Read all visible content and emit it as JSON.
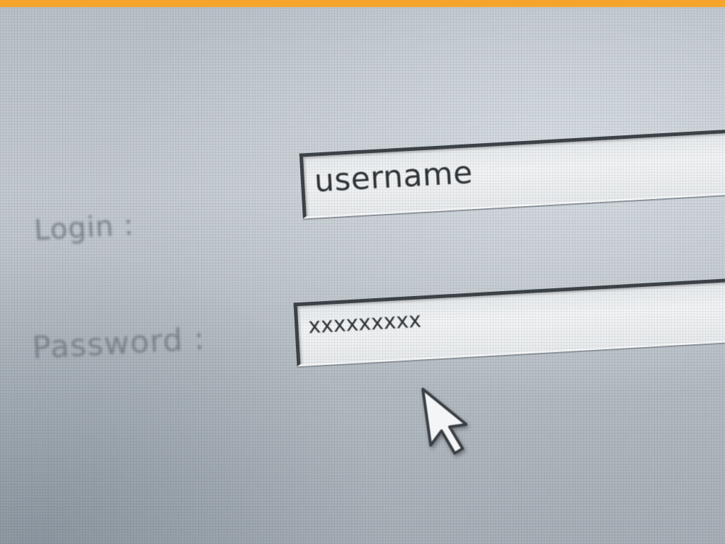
{
  "colors": {
    "accent_bar": "#f5a42c",
    "screen": "#bfc6cc",
    "field_border": "#3d4348",
    "label_text": "#7d858c"
  },
  "form": {
    "login_label": "Login :",
    "password_label": "Password :",
    "username_value": "username",
    "password_value": "xxxxxxxxx"
  },
  "cursor": {
    "icon": "arrow-cursor-icon"
  }
}
